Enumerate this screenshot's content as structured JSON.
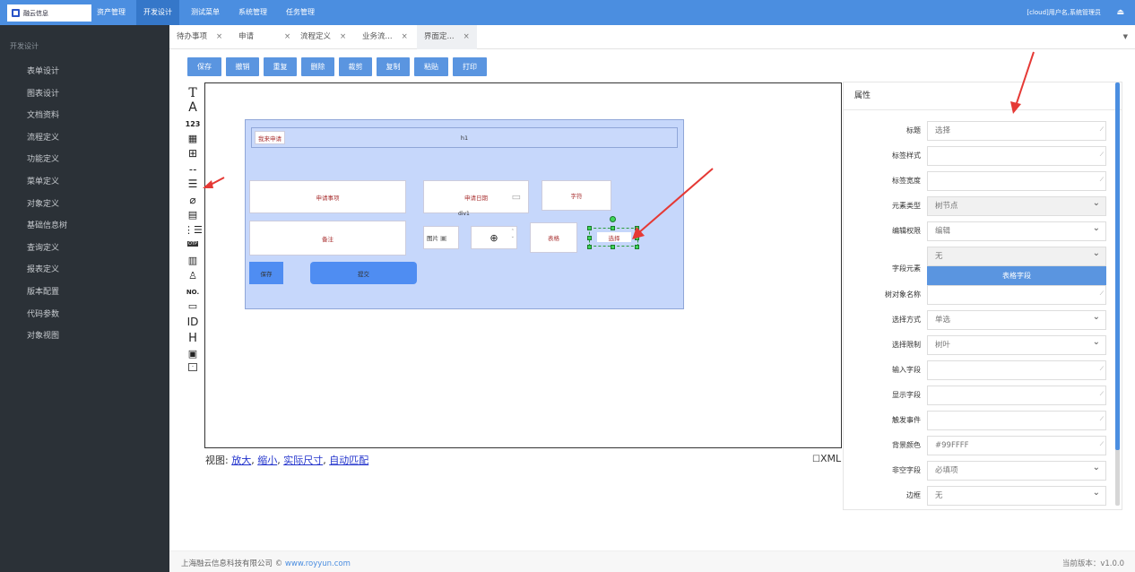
{
  "app": {
    "logo_text": "融云信息",
    "user": "[cloud]用户名,系统管理员"
  },
  "topnav": [
    "资产管理",
    "开发设计",
    "测试菜单",
    "系统管理",
    "任务管理"
  ],
  "sidebar": {
    "title": "开发设计",
    "items": [
      "表单设计",
      "图表设计",
      "文档资料",
      "流程定义",
      "功能定义",
      "菜单定义",
      "对象定义",
      "基础信息树",
      "查询定义",
      "报表定义",
      "版本配置",
      "代码参数",
      "对象视图"
    ]
  },
  "tabs": [
    {
      "label": "待办事项",
      "close": "×"
    },
    {
      "label": "申请",
      "close": "×"
    },
    {
      "label": "流程定义",
      "close": "×"
    },
    {
      "label": "业务流...",
      "close": "×"
    },
    {
      "label": "界面定...",
      "close": "×"
    }
  ],
  "toolbar": [
    "保存",
    "撤销",
    "重复",
    "删除",
    "裁剪",
    "复制",
    "粘贴",
    "打印"
  ],
  "palette": {
    "icons": [
      "text-icon",
      "label-icon",
      "number-icon",
      "calendar-icon",
      "table-icon",
      "tree-icon",
      "list-icon",
      "attachment-icon",
      "edit-icon",
      "checklist-icon",
      "otp-icon",
      "date-icon",
      "person-icon",
      "serial-icon",
      "textarea-icon",
      "id-icon",
      "heading-icon",
      "image-icon",
      "div-icon"
    ],
    "labels": {
      "t": "T",
      "a": "A",
      "num": "123",
      "no": "NO.",
      "id": "ID",
      "h": "H"
    }
  },
  "form": {
    "header_btn": "我来申请",
    "header_title": "h1",
    "f1": "申请事项",
    "f2": "申请日期",
    "f3": "字符",
    "div_label": "div1",
    "f4": "备注",
    "f5": "图片",
    "f7": "表格",
    "f8": "选择",
    "save": "保存",
    "submit": "提交"
  },
  "zoom": {
    "prefix": "视图:",
    "zoom_in": "放大",
    "zoom_out": "缩小",
    "actual": "实际尺寸",
    "fit": "自动匹配",
    "sep": ","
  },
  "xml_label": "XML",
  "panel": {
    "title": "属性",
    "rows": [
      {
        "label": "标题",
        "value": "选择",
        "kind": "text"
      },
      {
        "label": "标签样式",
        "value": "",
        "kind": "text"
      },
      {
        "label": "标签宽度",
        "value": "",
        "kind": "text"
      },
      {
        "label": "元素类型",
        "value": "树节点",
        "kind": "select-grey"
      },
      {
        "label": "编辑权限",
        "value": "编辑",
        "kind": "select"
      },
      {
        "label": "字段元素",
        "value": "无",
        "kind": "select-grey"
      },
      {
        "label": "树对象名称",
        "value": "",
        "kind": "text"
      },
      {
        "label": "选择方式",
        "value": "单选",
        "kind": "select"
      },
      {
        "label": "选择限制",
        "value": "树叶",
        "kind": "select"
      },
      {
        "label": "输入字段",
        "value": "",
        "kind": "text"
      },
      {
        "label": "显示字段",
        "value": "",
        "kind": "text"
      },
      {
        "label": "触发事件",
        "value": "",
        "kind": "text"
      },
      {
        "label": "背景颜色",
        "value": "#99FFFF",
        "kind": "text"
      },
      {
        "label": "非空字段",
        "value": "必填项",
        "kind": "select"
      },
      {
        "label": "边框",
        "value": "无",
        "kind": "select"
      }
    ],
    "table_field_btn": "表格字段"
  },
  "footer": {
    "company": "上海融云信息科技有限公司 ©",
    "site": "www.royyun.com",
    "version": "当前版本：v1.0.0"
  },
  "colors": {
    "topbar": "#4b8ee0",
    "sidebar": "#2b3137",
    "button": "#5a95e0",
    "form_bg": "#c6d7fb",
    "arrow": "#e53935"
  }
}
